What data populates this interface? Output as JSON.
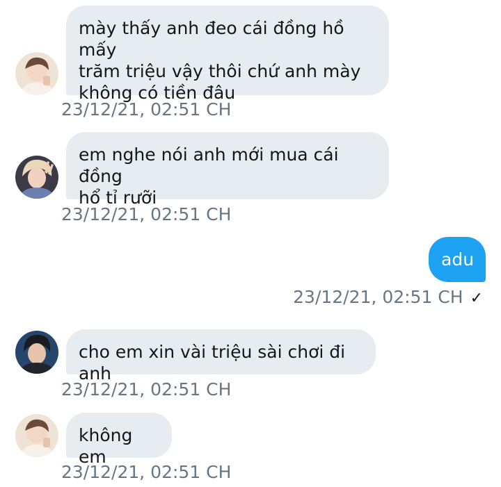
{
  "messages": [
    {
      "direction": "incoming",
      "avatar": "avatar-1",
      "text": "mày thấy anh đeo cái đồng hồ mấy\ntrăm triệu vậy thôi chứ anh mày\nkhông có tiền đâu",
      "time": "23/12/21, 02:51 CH"
    },
    {
      "direction": "incoming",
      "avatar": "avatar-2",
      "text": "em nghe nói anh mới mua cái đồng\nhổ tỉ rưỡi",
      "time": "23/12/21, 02:51 CH"
    },
    {
      "direction": "outgoing",
      "text": "adu",
      "time": "23/12/21, 02:51 CH",
      "status_icon": "check-icon",
      "status_glyph": "✓"
    },
    {
      "direction": "incoming",
      "avatar": "avatar-3",
      "text": "cho em xin vài triệu sài chơi đi anh",
      "time": "23/12/21, 02:51 CH"
    },
    {
      "direction": "incoming",
      "avatar": "avatar-1",
      "text": "không em",
      "time": "23/12/21, 02:51 CH"
    }
  ],
  "colors": {
    "incoming_bubble": "#e6ecf0",
    "outgoing_bubble": "#1da1f2",
    "timestamp": "#657786"
  }
}
